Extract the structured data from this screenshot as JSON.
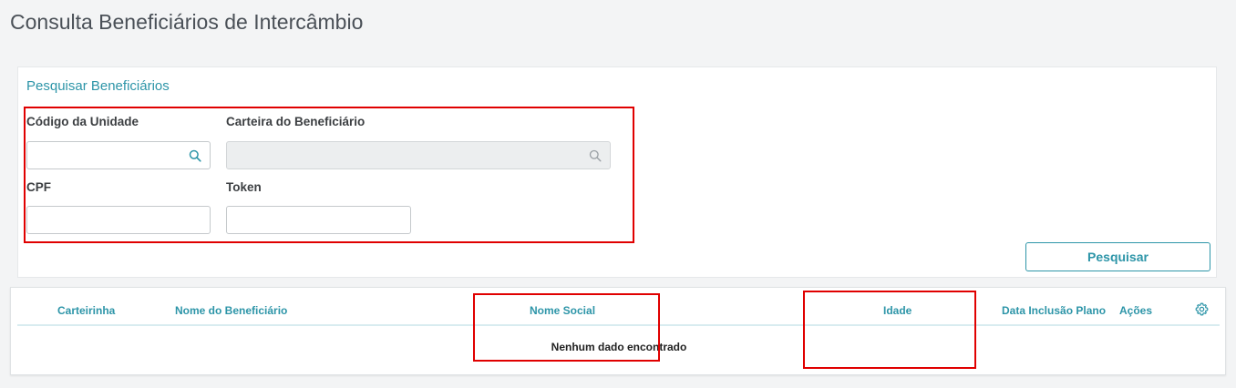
{
  "page": {
    "title": "Consulta Beneficiários de Intercâmbio"
  },
  "search": {
    "title": "Pesquisar Beneficiários",
    "fields": {
      "codigo_unidade": {
        "label": "Código da Unidade",
        "value": "",
        "icon": "search-icon"
      },
      "carteira": {
        "label": "Carteira do Beneficiário",
        "value": "",
        "icon": "search-icon",
        "disabled": true
      },
      "cpf": {
        "label": "CPF",
        "value": ""
      },
      "token": {
        "label": "Token",
        "value": ""
      }
    },
    "button_label": "Pesquisar"
  },
  "table": {
    "columns": [
      "Carteirinha",
      "Nome do Beneficiário",
      "Nome Social",
      "Idade",
      "Data Inclusão Plano",
      "Ações"
    ],
    "settings_icon": "gear-icon",
    "empty_message": "Nenhum dado encontrado",
    "rows": []
  },
  "colors": {
    "accent": "#2d95a8",
    "highlight": "#e00000",
    "background": "#f3f4f5"
  }
}
